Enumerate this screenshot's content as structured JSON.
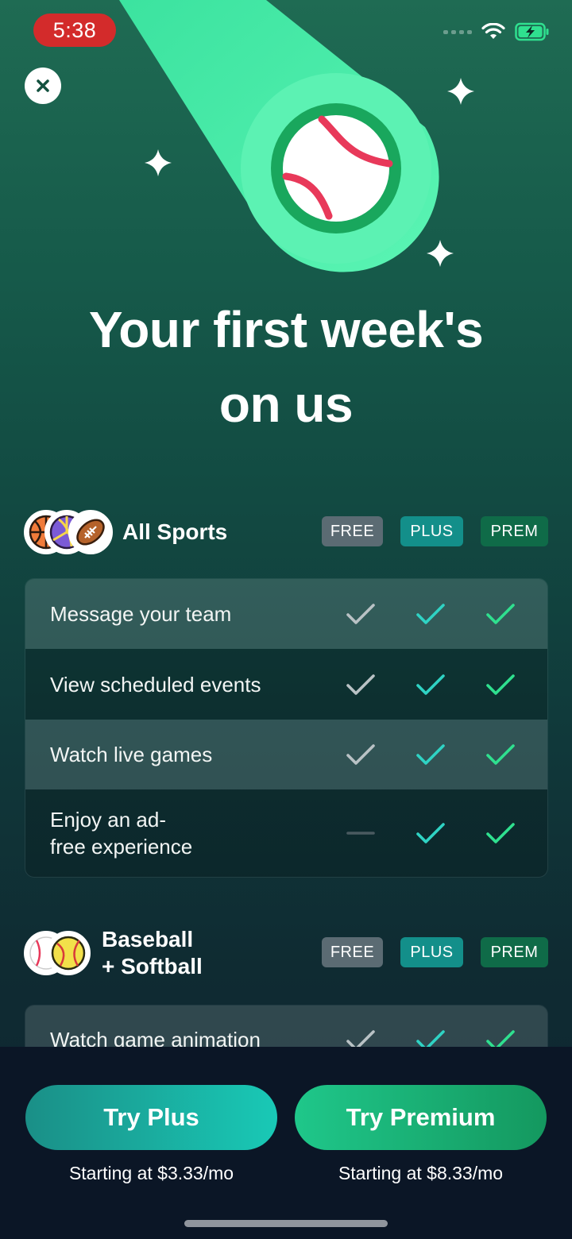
{
  "status_bar": {
    "time": "5:38"
  },
  "headline": {
    "line1": "Your first week's",
    "line2": "on us"
  },
  "tiers": {
    "free": "FREE",
    "plus": "PLUS",
    "prem": "PREM"
  },
  "sections": [
    {
      "title": "All Sports",
      "rows": [
        {
          "label": "Message your team",
          "free": "check",
          "plus": "check",
          "prem": "check"
        },
        {
          "label": "View scheduled events",
          "free": "check",
          "plus": "check",
          "prem": "check"
        },
        {
          "label": "Watch live games",
          "free": "check",
          "plus": "check",
          "prem": "check"
        },
        {
          "label_line1": "Enjoy an ad-",
          "label_line2": "free experience",
          "free": "dash",
          "plus": "check",
          "prem": "check"
        }
      ]
    },
    {
      "title_line1": "Baseball",
      "title_line2": "+ Softball",
      "rows": [
        {
          "label": "Watch game animation",
          "free": "check",
          "plus": "check",
          "prem": "check"
        }
      ]
    }
  ],
  "cta": {
    "plus_label": "Try Plus",
    "plus_price": "Starting at $3.33/mo",
    "premium_label": "Try Premium",
    "premium_price": "Starting at $8.33/mo"
  },
  "colors": {
    "check_free": "#b9c2c5",
    "check_plus": "#2fd3c4",
    "check_prem": "#2fe08f",
    "badge_free": "#5b6b73",
    "badge_plus": "#138f8a",
    "badge_prem": "#0f6b48"
  }
}
